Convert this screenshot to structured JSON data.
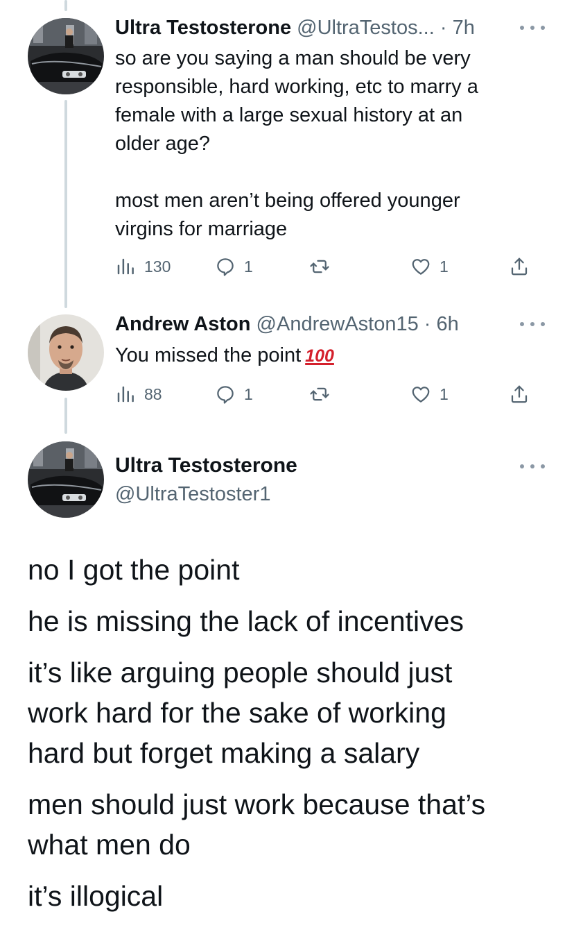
{
  "tweet1": {
    "name": "Ultra Testosterone",
    "handle": "@UltraTestos...",
    "dot": "·",
    "time": "7h",
    "lines": [
      "so are you saying a man should be very",
      "responsible, hard working, etc to marry a",
      "female with a large sexual history at an",
      "older age?",
      "most men aren’t being offered younger",
      "virgins for marriage"
    ],
    "views": "130",
    "replies": "1",
    "likes": "1"
  },
  "tweet2": {
    "name": "Andrew Aston",
    "handle": "@AndrewAston15",
    "dot": "·",
    "time": "6h",
    "text": "You missed the point",
    "emoji": "100",
    "views": "88",
    "replies": "1",
    "likes": "1"
  },
  "main_tweet": {
    "name": "Ultra Testosterone",
    "handle": "@UltraTestoster1",
    "paragraphs": [
      "no I got the point",
      "he is missing the lack of incentives",
      "it’s like arguing people should just",
      "work hard for the sake of working",
      "hard but forget making a salary",
      "men should just work because that’s",
      "what men do",
      "it’s illogical"
    ]
  },
  "icons": {
    "views": "bar-chart-icon",
    "reply": "speech-bubble-icon",
    "retweet": "retweet-arrows-icon",
    "like": "heart-icon",
    "share": "share-upload-icon",
    "more": "ellipsis-icon"
  },
  "colors": {
    "text": "#0f1419",
    "secondary": "#536471",
    "thread_line": "#cfd9de",
    "emoji_red": "#d4202c"
  }
}
